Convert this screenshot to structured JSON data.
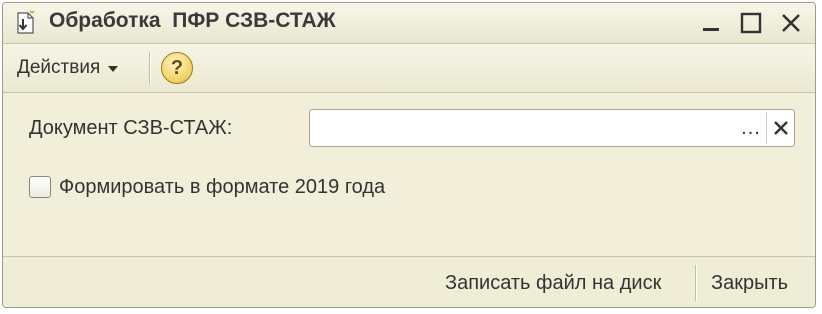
{
  "window": {
    "title": "Обработка  ПФР СЗВ-СТАЖ",
    "icons": {
      "app": "document-arrow-icon",
      "minimize": "minimize-icon",
      "maximize": "maximize-icon",
      "close": "close-icon"
    }
  },
  "toolbar": {
    "actions_label": "Действия",
    "help_glyph": "?"
  },
  "form": {
    "document_label": "Документ СЗВ-СТАЖ:",
    "document_value": "",
    "select_button_label": "...",
    "format_2019_label": "Формировать в формате 2019 года",
    "format_2019_checked": false
  },
  "footer": {
    "write_file_label": "Записать файл на диск",
    "close_label": "Закрыть"
  },
  "colors": {
    "window_bg": "#f1efd9",
    "border": "#9a9c8c",
    "text": "#333333",
    "help_icon": "#f2d060"
  }
}
